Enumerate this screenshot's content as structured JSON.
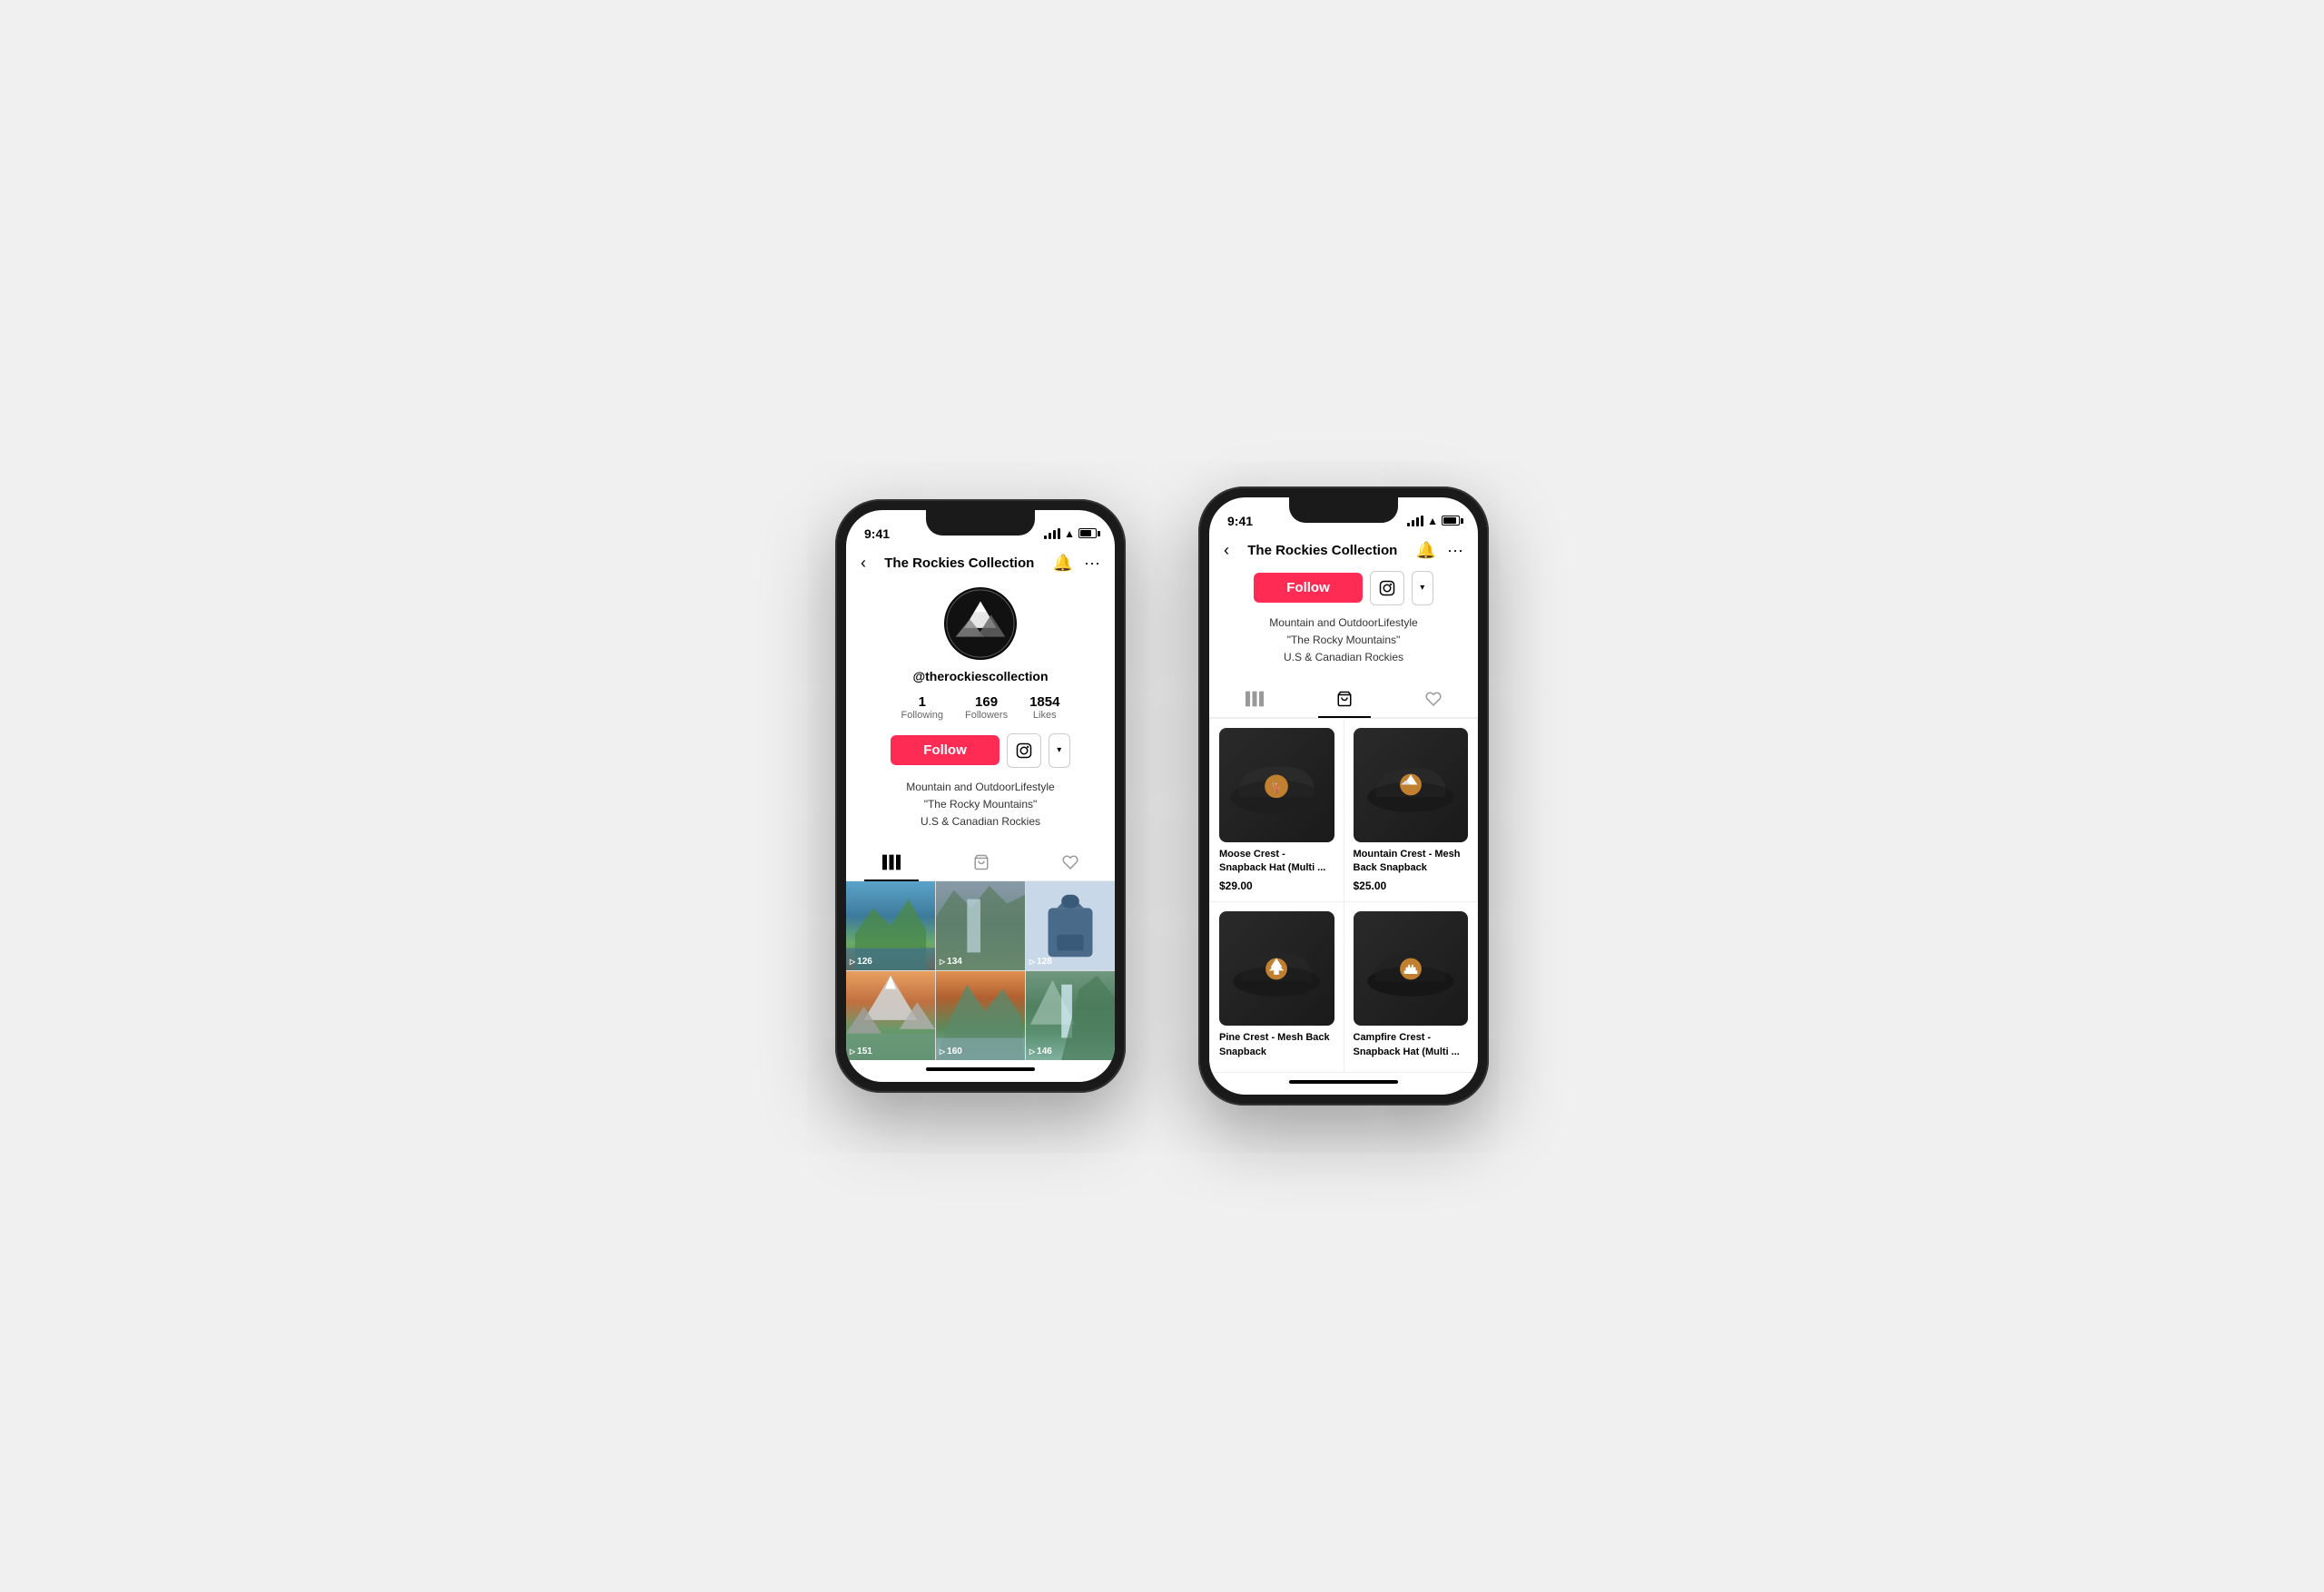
{
  "scene": {
    "background": "#f0f0f0"
  },
  "phone1": {
    "status": {
      "time": "9:41",
      "signal": 4,
      "wifi": true,
      "battery": 75
    },
    "nav": {
      "back_icon": "‹",
      "title": "The Rockies Collection",
      "notification_icon": "🔔",
      "more_icon": "···"
    },
    "profile": {
      "username": "@therockiescollection",
      "stats": [
        {
          "num": "1",
          "label": "Following"
        },
        {
          "num": "169",
          "label": "Followers"
        },
        {
          "num": "1854",
          "label": "Likes"
        }
      ],
      "follow_label": "Follow",
      "bio_lines": [
        "Mountain and OutdoorLifestyle",
        "\"The Rocky Mountains\"",
        "U.S & Canadian Rockies"
      ]
    },
    "tabs": [
      {
        "id": "videos",
        "icon": "|||",
        "active": true
      },
      {
        "id": "shop",
        "icon": "🛍"
      },
      {
        "id": "liked",
        "icon": "🤍"
      }
    ],
    "videos": [
      {
        "count": "126"
      },
      {
        "count": "134"
      },
      {
        "count": "128"
      },
      {
        "count": "151"
      },
      {
        "count": "160"
      },
      {
        "count": "146"
      }
    ]
  },
  "phone2": {
    "status": {
      "time": "9:41",
      "signal": 4,
      "wifi": true,
      "battery": 90
    },
    "nav": {
      "back_icon": "‹",
      "title": "The Rockies Collection",
      "notification_icon": "🔔",
      "more_icon": "···"
    },
    "profile": {
      "follow_label": "Follow",
      "bio_lines": [
        "Mountain and OutdoorLifestyle",
        "\"The Rocky Mountains\"",
        "U.S & Canadian Rockies"
      ]
    },
    "tabs": [
      {
        "id": "videos",
        "icon": "|||"
      },
      {
        "id": "shop",
        "icon": "🛍",
        "active": true
      },
      {
        "id": "liked",
        "icon": "🤍"
      }
    ],
    "products": [
      {
        "id": "moose-hat",
        "name": "Moose Crest - Snapback Hat (Multi ...",
        "price": "$29.00",
        "badge_color": "#c08030",
        "badge_icon": "moose"
      },
      {
        "id": "mountain-hat",
        "name": "Mountain Crest - Mesh Back Snapback",
        "price": "$25.00",
        "badge_color": "#c08030",
        "badge_icon": "mountain"
      },
      {
        "id": "pine-hat",
        "name": "Pine Crest - Mesh Back Snapback",
        "price": "",
        "badge_color": "#c08030",
        "badge_icon": "pine"
      },
      {
        "id": "campfire-hat",
        "name": "Campfire Crest - Snapback Hat (Multi ...",
        "price": "",
        "badge_color": "#c08030",
        "badge_icon": "campfire"
      }
    ]
  }
}
